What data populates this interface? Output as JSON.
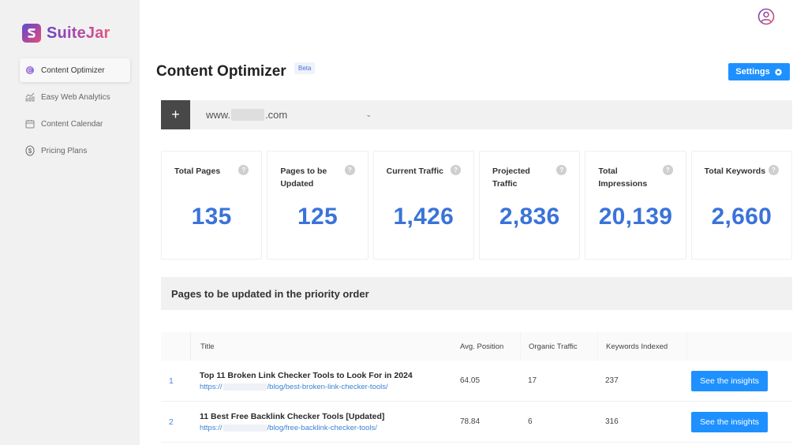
{
  "brand": {
    "name": "SuiteJar"
  },
  "sidebar": {
    "items": [
      {
        "label": "Content Optimizer",
        "icon": "content-optimizer-icon",
        "active": true
      },
      {
        "label": "Easy Web Analytics",
        "icon": "analytics-icon",
        "active": false
      },
      {
        "label": "Content Calendar",
        "icon": "calendar-icon",
        "active": false
      },
      {
        "label": "Pricing Plans",
        "icon": "dollar-icon",
        "active": false
      }
    ]
  },
  "header": {
    "title": "Content Optimizer",
    "badge": "Beta",
    "settings_label": "Settings"
  },
  "domain_bar": {
    "add_label": "+",
    "domain_prefix": "www.",
    "domain_suffix": ".com",
    "caret": "⌄"
  },
  "stats": [
    {
      "label": "Total Pages",
      "value": "135"
    },
    {
      "label": "Pages to be Updated",
      "value": "125"
    },
    {
      "label": "Current Traffic",
      "value": "1,426"
    },
    {
      "label": "Projected Traffic",
      "value": "2,836"
    },
    {
      "label": "Total Impressions",
      "value": "20,139"
    },
    {
      "label": "Total Keywords",
      "value": "2,660"
    }
  ],
  "help_glyph": "?",
  "section": {
    "title": "Pages to be updated in the priority order"
  },
  "table": {
    "columns": [
      "",
      "Title",
      "Avg. Position",
      "Organic Traffic",
      "Keywords Indexed",
      ""
    ],
    "rows": [
      {
        "num": "1",
        "title": "Top 11 Broken Link Checker Tools to Look For in 2024",
        "url_prefix": "https://",
        "url_suffix": "/blog/best-broken-link-checker-tools/",
        "avg_position": "64.05",
        "organic_traffic": "17",
        "keywords_indexed": "237",
        "action": "See the insights"
      },
      {
        "num": "2",
        "title": "11 Best Free Backlink Checker Tools [Updated]",
        "url_prefix": "https://",
        "url_suffix": "/blog/free-backlink-checker-tools/",
        "avg_position": "78.84",
        "organic_traffic": "6",
        "keywords_indexed": "316",
        "action": "See the insights"
      }
    ]
  },
  "colors": {
    "accent": "#1e90ff",
    "stat_value": "#3a73d9",
    "sidebar_bg": "#f1f1f1",
    "link": "#3b82d6"
  }
}
